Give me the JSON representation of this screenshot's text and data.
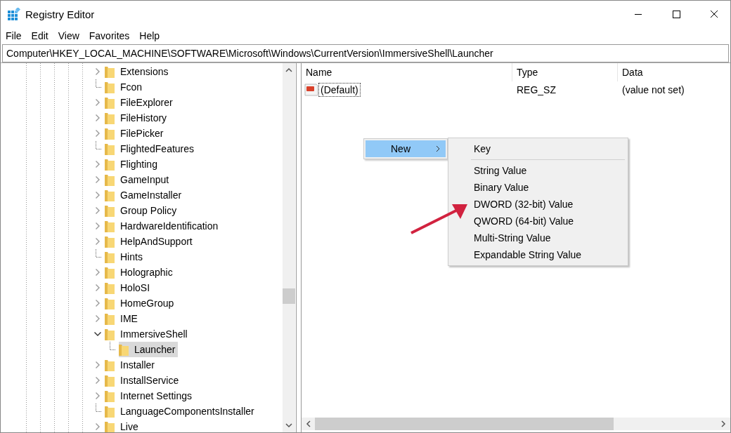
{
  "window": {
    "title": "Registry Editor"
  },
  "menu_bar": [
    "File",
    "Edit",
    "View",
    "Favorites",
    "Help"
  ],
  "address_bar": {
    "value": "Computer\\HKEY_LOCAL_MACHINE\\SOFTWARE\\Microsoft\\Windows\\CurrentVersion\\ImmersiveShell\\Launcher"
  },
  "tree": [
    {
      "label": "Extensions",
      "has_children": true,
      "expanded": false,
      "selected": false
    },
    {
      "label": "Fcon",
      "has_children": false,
      "selected": false
    },
    {
      "label": "FileExplorer",
      "has_children": true,
      "expanded": false,
      "selected": false
    },
    {
      "label": "FileHistory",
      "has_children": true,
      "expanded": false,
      "selected": false
    },
    {
      "label": "FilePicker",
      "has_children": true,
      "expanded": false,
      "selected": false
    },
    {
      "label": "FlightedFeatures",
      "has_children": false,
      "selected": false
    },
    {
      "label": "Flighting",
      "has_children": true,
      "expanded": false,
      "selected": false
    },
    {
      "label": "GameInput",
      "has_children": true,
      "expanded": false,
      "selected": false
    },
    {
      "label": "GameInstaller",
      "has_children": true,
      "expanded": false,
      "selected": false
    },
    {
      "label": "Group Policy",
      "has_children": true,
      "expanded": false,
      "selected": false
    },
    {
      "label": "HardwareIdentification",
      "has_children": true,
      "expanded": false,
      "selected": false
    },
    {
      "label": "HelpAndSupport",
      "has_children": true,
      "expanded": false,
      "selected": false
    },
    {
      "label": "Hints",
      "has_children": false,
      "selected": false
    },
    {
      "label": "Holographic",
      "has_children": true,
      "expanded": false,
      "selected": false
    },
    {
      "label": "HoloSI",
      "has_children": true,
      "expanded": false,
      "selected": false
    },
    {
      "label": "HomeGroup",
      "has_children": true,
      "expanded": false,
      "selected": false
    },
    {
      "label": "IME",
      "has_children": true,
      "expanded": false,
      "selected": false
    },
    {
      "label": "ImmersiveShell",
      "has_children": true,
      "expanded": true,
      "selected": false,
      "children": [
        {
          "label": "Launcher",
          "has_children": false,
          "selected": true
        }
      ]
    },
    {
      "label": "Installer",
      "has_children": true,
      "expanded": false,
      "selected": false
    },
    {
      "label": "InstallService",
      "has_children": true,
      "expanded": false,
      "selected": false
    },
    {
      "label": "Internet Settings",
      "has_children": true,
      "expanded": false,
      "selected": false
    },
    {
      "label": "LanguageComponentsInstaller",
      "has_children": false,
      "selected": false
    },
    {
      "label": "Live",
      "has_children": true,
      "expanded": false,
      "selected": false
    }
  ],
  "values_table": {
    "columns": [
      "Name",
      "Type",
      "Data"
    ],
    "rows": [
      {
        "name": "(Default)",
        "type": "REG_SZ",
        "data": "(value not set)",
        "focused": true
      }
    ]
  },
  "context_menu": {
    "items": [
      {
        "label": "New",
        "selected": true
      }
    ]
  },
  "submenu": {
    "items": [
      {
        "label": "Key",
        "separator": true
      },
      {
        "label": "String Value",
        "separator": false
      },
      {
        "label": "Binary Value",
        "separator": false
      },
      {
        "label": "DWORD (32-bit) Value",
        "separator": false
      },
      {
        "label": "QWORD (64-bit) Value",
        "separator": false
      },
      {
        "label": "Multi-String Value",
        "separator": false
      },
      {
        "label": "Expandable String Value",
        "separator": false
      }
    ]
  }
}
